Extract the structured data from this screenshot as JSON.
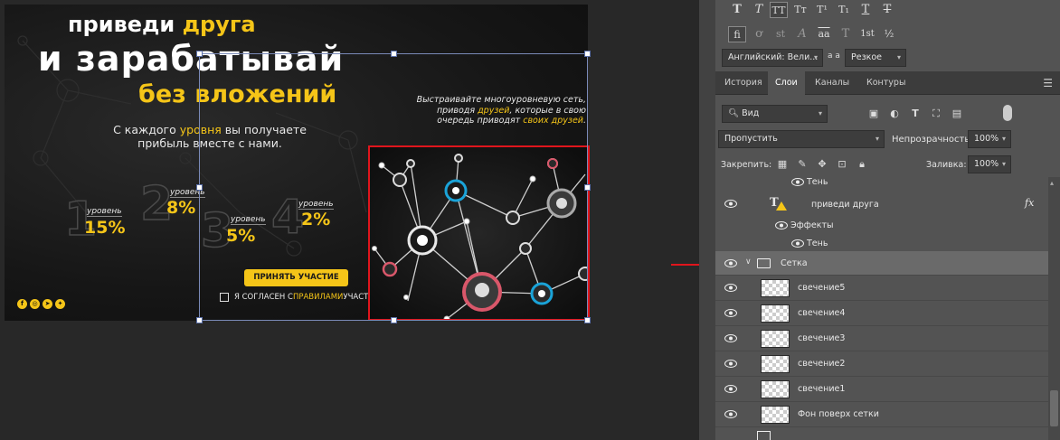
{
  "banner": {
    "headline_part1": "приведи ",
    "headline_part1_yellow": "друга",
    "headline_line2": "и зарабатывай",
    "headline_line3": "без вложений",
    "sub_left_1": "С каждого ",
    "sub_left_yellow": "уровня",
    "sub_left_2": " вы получаете",
    "sub_left_3": "прибыль вместе с нами.",
    "sub_right_1": "Выстраивайте многоуровневую сеть,",
    "sub_right_2a": "приводя ",
    "sub_right_2y": "друзей",
    "sub_right_2b": ", которые в свою",
    "sub_right_3a": "очередь приводят ",
    "sub_right_3y": "своих друзей",
    "sub_right_3b": ".",
    "levels": [
      {
        "num": "1",
        "word": "уровень",
        "pct": "15%"
      },
      {
        "num": "2",
        "word": "уровень",
        "pct": "8%"
      },
      {
        "num": "3",
        "word": "уровень",
        "pct": "5%"
      },
      {
        "num": "4",
        "word": "уровень",
        "pct": "2%"
      }
    ],
    "cta_label": "ПРИНЯТЬ УЧАСТИЕ",
    "agree_1": "Я СОГЛАСЕН С ",
    "agree_yellow": "ПРАВИЛАМИ",
    "agree_2": " УЧАСТИЯ",
    "socials": [
      "f",
      "◎",
      "➤",
      "✦"
    ]
  },
  "toolbar": {
    "glyph_row1": [
      "T",
      "T",
      "TT",
      "Tт",
      "T¹",
      "T₁",
      "T",
      "T"
    ],
    "glyph_row2": [
      "fi",
      "ơ",
      "st",
      "A",
      "aa",
      "T",
      "1st",
      "½"
    ],
    "language": "Английский: Вели...",
    "aa_label": "a a",
    "antialias": "Резкое"
  },
  "tabs": [
    "История",
    "Слои",
    "Каналы",
    "Контуры"
  ],
  "filter": {
    "kind": "Вид"
  },
  "blend": {
    "mode": "Пропустить",
    "opacity_label": "Непрозрачность:",
    "opacity_value": "100%"
  },
  "lock": {
    "label": "Закрепить:",
    "fill_label": "Заливка:",
    "fill_value": "100%"
  },
  "layers": [
    {
      "name": "Тень",
      "type": "effect"
    },
    {
      "name": "приведи друга",
      "type": "text",
      "fx": "fx"
    },
    {
      "name": "Эффекты",
      "type": "effects-header"
    },
    {
      "name": "Тень",
      "type": "effect"
    },
    {
      "name": "Сетка",
      "type": "group"
    },
    {
      "name": "свечение5",
      "type": "layer"
    },
    {
      "name": "свечение4",
      "type": "layer"
    },
    {
      "name": "свечение3",
      "type": "layer"
    },
    {
      "name": "свечение2",
      "type": "layer"
    },
    {
      "name": "свечение1",
      "type": "layer"
    },
    {
      "name": "Фон поверх сетки",
      "type": "layer"
    }
  ],
  "colors": {
    "accent_yellow": "#f5c518",
    "highlight_red": "#e0151c",
    "node_blue": "#1aa3d8",
    "node_pink": "#d9576a"
  }
}
